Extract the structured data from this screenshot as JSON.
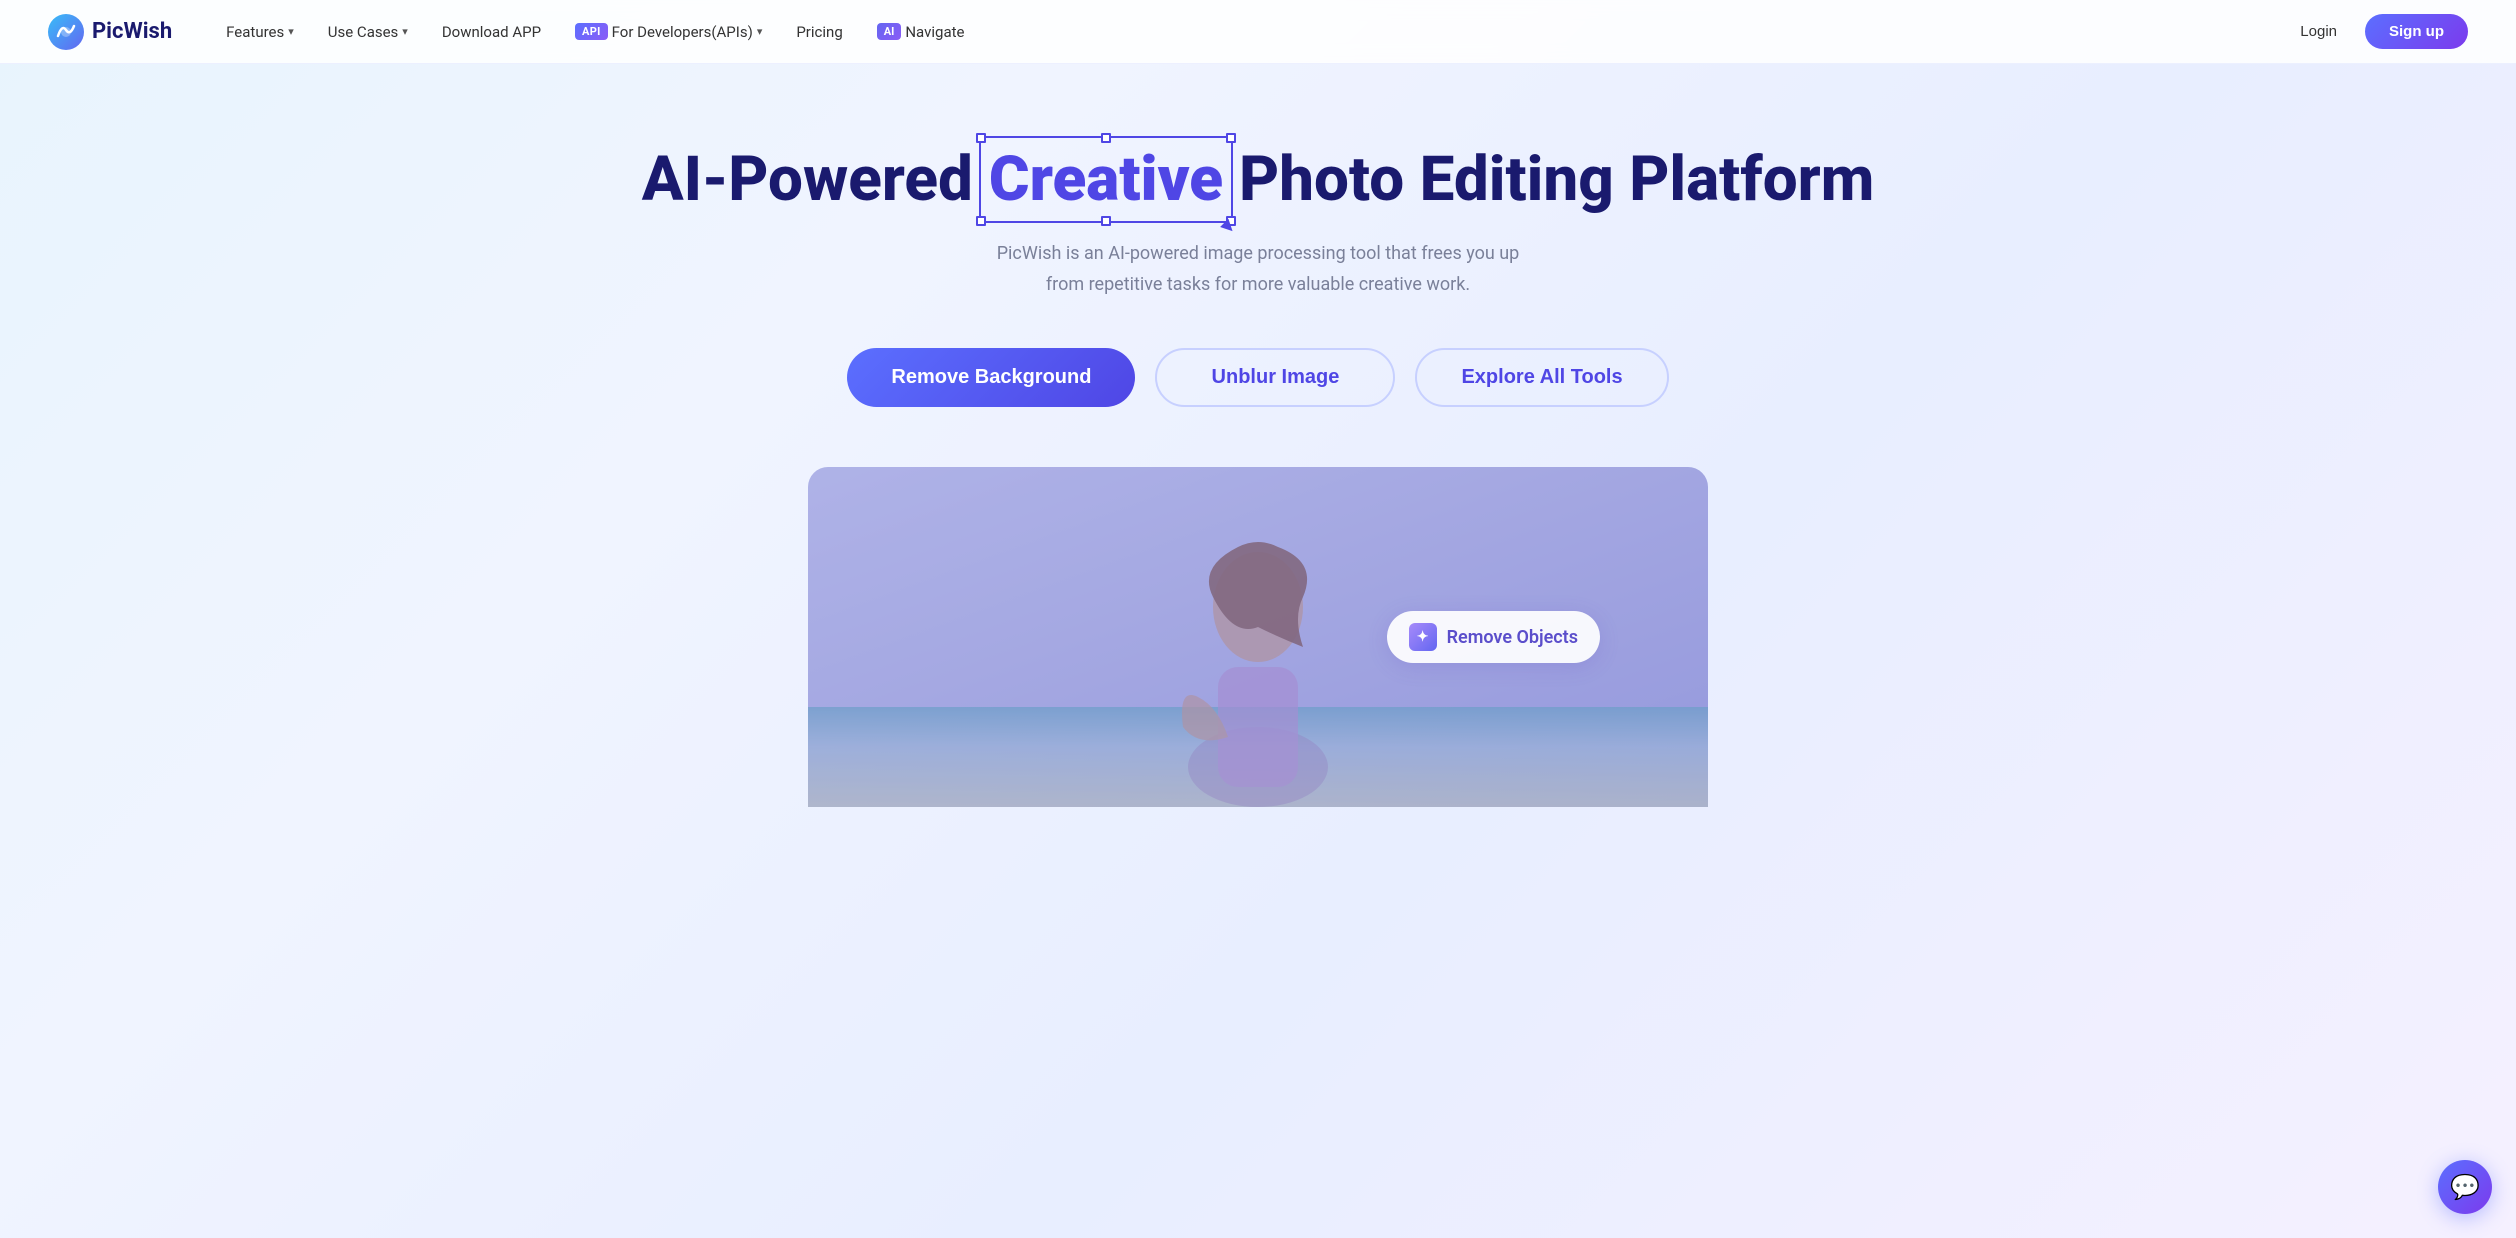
{
  "brand": {
    "name": "PicWish",
    "logo_alt": "PicWish logo"
  },
  "navbar": {
    "links": [
      {
        "id": "features",
        "label": "Features",
        "has_dropdown": true
      },
      {
        "id": "use-cases",
        "label": "Use Cases",
        "has_dropdown": true
      },
      {
        "id": "download",
        "label": "Download APP",
        "has_dropdown": false
      },
      {
        "id": "developers",
        "label": "For Developers(APIs)",
        "has_dropdown": true,
        "badge": "API"
      },
      {
        "id": "pricing",
        "label": "Pricing",
        "has_dropdown": false
      },
      {
        "id": "navigate",
        "label": "Navigate",
        "has_dropdown": false,
        "badge": "AI"
      }
    ],
    "login_label": "Login",
    "signup_label": "Sign up"
  },
  "hero": {
    "title_before": "AI-Powered",
    "title_highlight": "Creative",
    "title_after": "Photo Editing Platform",
    "subtitle": "PicWish is an AI-powered image processing tool that frees you up from repetitive tasks for more valuable creative work.",
    "cta_primary": "Remove Background",
    "cta_secondary_1": "Unblur Image",
    "cta_secondary_2": "Explore All Tools"
  },
  "hero_image": {
    "remove_objects_label": "Remove Objects",
    "remove_objects_icon": "✦"
  },
  "chat": {
    "icon": "💬"
  }
}
